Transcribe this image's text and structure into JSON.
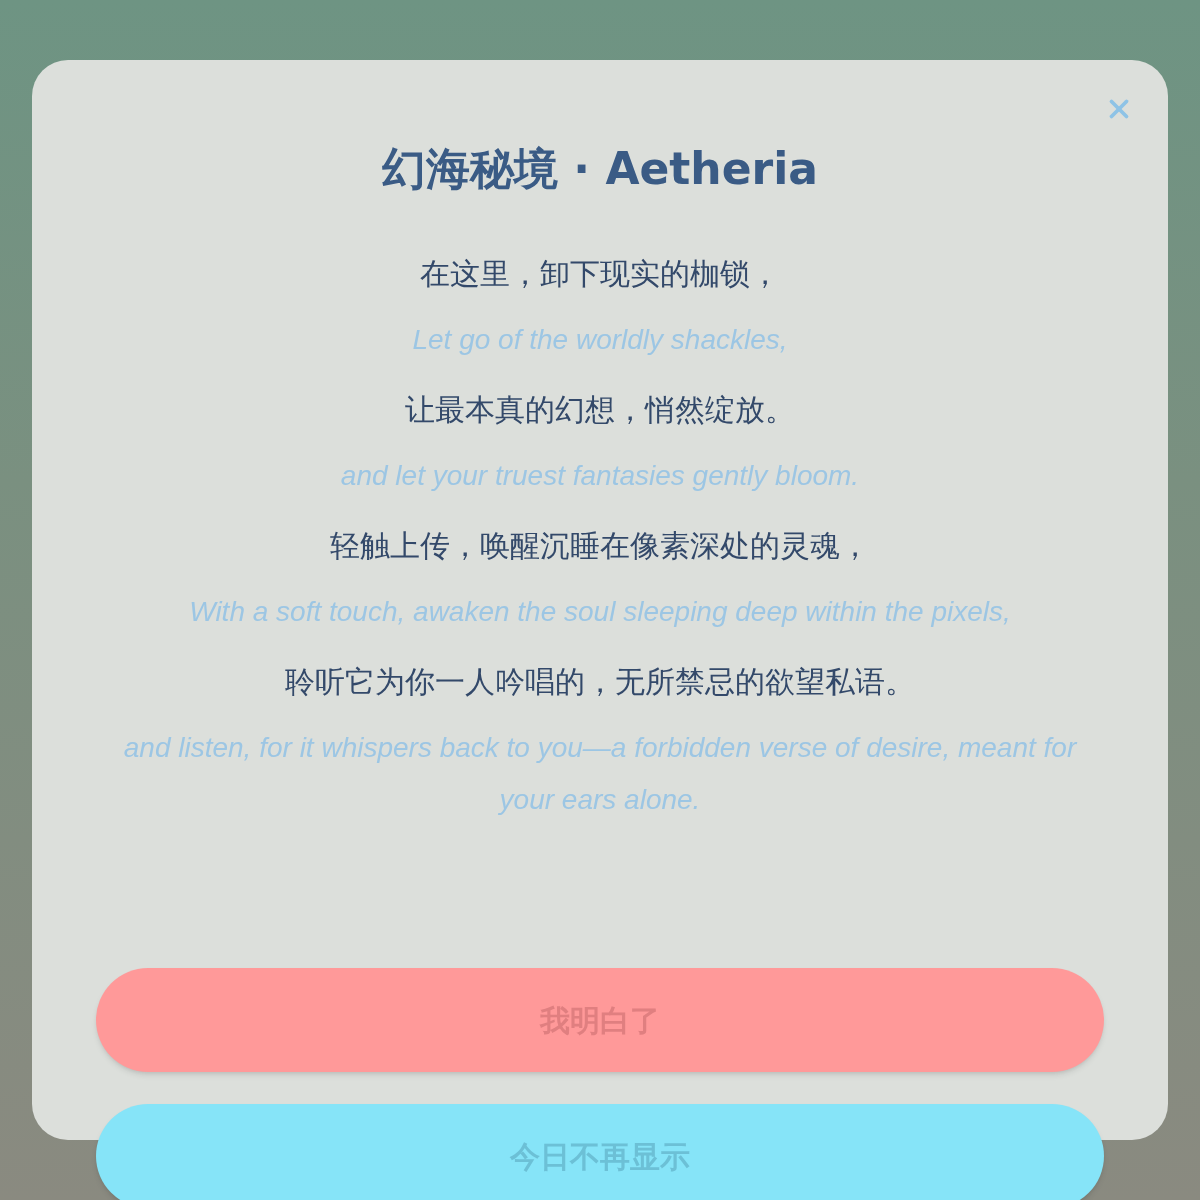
{
  "dialog": {
    "title": "幻海秘境 · Aetheria",
    "verses": [
      {
        "zh": "在这里，卸下现实的枷锁，",
        "en": "Let go of the worldly shackles,"
      },
      {
        "zh": "让最本真的幻想，悄然绽放。",
        "en": "and let your truest fantasies gently bloom."
      },
      {
        "zh": "轻触上传，唤醒沉睡在像素深处的灵魂，",
        "en": "With a soft touch, awaken the soul sleeping deep within the pixels,"
      },
      {
        "zh": "聆听它为你一人吟唱的，无所禁忌的欲望私语。",
        "en": "and listen, for it whispers back to you—a forbidden verse of desire, meant for your ears alone."
      }
    ],
    "buttons": [
      {
        "label": "我明白了",
        "kind": "primary"
      },
      {
        "label": "今日不再显示",
        "kind": "secondary"
      }
    ]
  }
}
